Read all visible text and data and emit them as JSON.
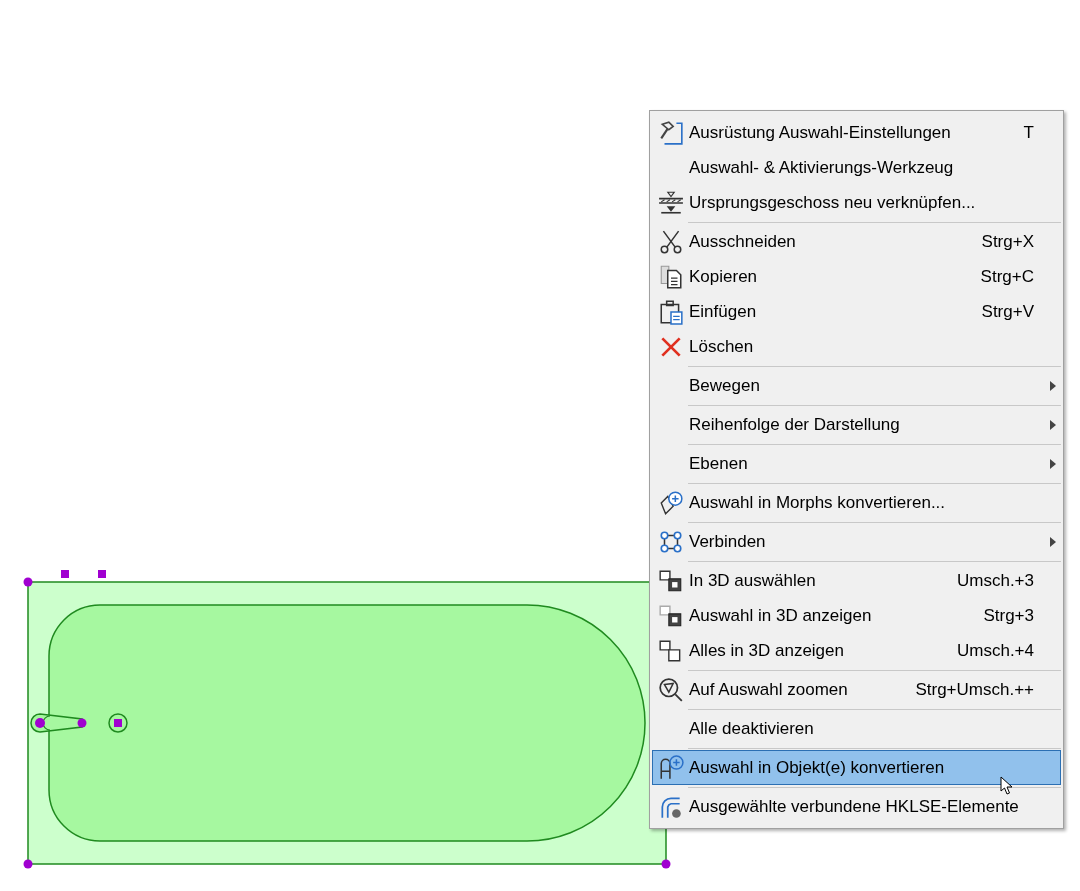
{
  "context_menu": {
    "groups": [
      [
        {
          "label": "Ausrüstung Auswahl-Einstellungen",
          "shortcut": "T",
          "submenu": false,
          "selected": false
        },
        {
          "label": "Auswahl- & Aktivierungs-Werkzeug",
          "submenu": false,
          "selected": false
        },
        {
          "label": "Ursprungsgeschoss neu verknüpfen...",
          "submenu": false,
          "selected": false
        }
      ],
      [
        {
          "label": "Ausschneiden",
          "shortcut": "Strg+X",
          "submenu": false,
          "selected": false
        },
        {
          "label": "Kopieren",
          "shortcut": "Strg+C",
          "submenu": false,
          "selected": false
        },
        {
          "label": "Einfügen",
          "shortcut": "Strg+V",
          "submenu": false,
          "selected": false
        },
        {
          "label": "Löschen",
          "submenu": false,
          "selected": false
        }
      ],
      [
        {
          "label": "Bewegen",
          "submenu": true,
          "selected": false
        }
      ],
      [
        {
          "label": "Reihenfolge der Darstellung",
          "submenu": true,
          "selected": false
        }
      ],
      [
        {
          "label": "Ebenen",
          "submenu": true,
          "selected": false
        }
      ],
      [
        {
          "label": "Auswahl in Morphs konvertieren...",
          "submenu": false,
          "selected": false
        }
      ],
      [
        {
          "label": "Verbinden",
          "submenu": true,
          "selected": false
        }
      ],
      [
        {
          "label": "In 3D auswählen",
          "shortcut": "Umsch.+3",
          "submenu": false,
          "selected": false
        },
        {
          "label": "Auswahl in 3D anzeigen",
          "shortcut": "Strg+3",
          "submenu": false,
          "selected": false
        },
        {
          "label": "Alles in 3D anzeigen",
          "shortcut": "Umsch.+4",
          "submenu": false,
          "selected": false
        }
      ],
      [
        {
          "label": "Auf Auswahl zoomen",
          "shortcut": "Strg+Umsch.++",
          "submenu": false,
          "selected": false
        }
      ],
      [
        {
          "label": "Alle deaktivieren",
          "submenu": false,
          "selected": false
        }
      ],
      [
        {
          "label": "Auswahl in Objekt(e) konvertieren",
          "submenu": false,
          "selected": true
        }
      ],
      [
        {
          "label": "Ausgewählte verbundene HKLSE-Elemente",
          "submenu": false,
          "selected": false
        }
      ]
    ]
  }
}
